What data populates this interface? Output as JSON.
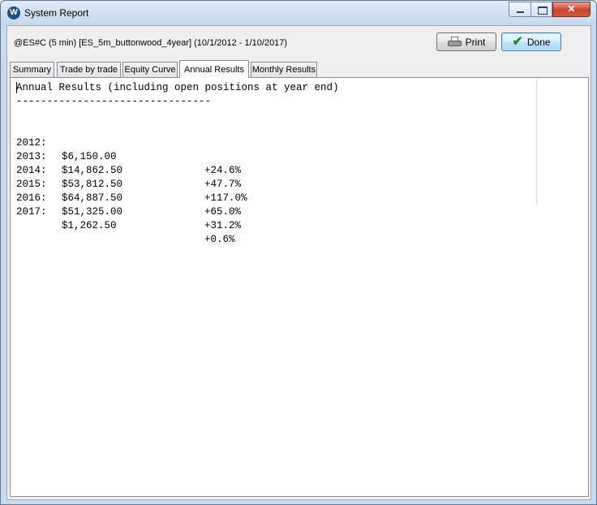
{
  "window": {
    "title": "System Report",
    "icon": "W"
  },
  "header": {
    "label": "@ES#C (5 min) [ES_5m_buttonwood_4year]  (10/1/2012 - 1/10/2017)",
    "print_label": "Print",
    "done_label": "Done"
  },
  "tabs": [
    {
      "label": "Summary"
    },
    {
      "label": "Trade by trade"
    },
    {
      "label": "Equity Curve"
    },
    {
      "label": "Annual Results",
      "active": true
    },
    {
      "label": "Monthly Results"
    }
  ],
  "report": {
    "heading": "Annual Results (including open positions at year end)",
    "divider": "--------------------------------",
    "rows": [
      {
        "year": "2012:",
        "amount": "$6,150.00",
        "pct": "+24.6%"
      },
      {
        "year": "2013:",
        "amount": "$14,862.50",
        "pct": "+47.7%"
      },
      {
        "year": "2014:",
        "amount": "$53,812.50",
        "pct": "+117.0%"
      },
      {
        "year": "2015:",
        "amount": "$64,887.50",
        "pct": "+65.0%"
      },
      {
        "year": "2016:",
        "amount": "$51,325.00",
        "pct": "+31.2%"
      },
      {
        "year": "2017:",
        "amount": "$1,262.50",
        "pct": "+0.6%"
      }
    ]
  }
}
